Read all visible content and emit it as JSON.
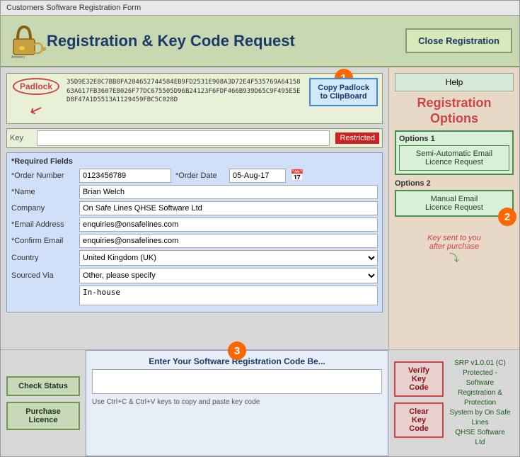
{
  "window": {
    "title": "Customers Software Registration Form"
  },
  "header": {
    "title": "Registration & Key Code Request",
    "close_btn": "Close Registration"
  },
  "padlock": {
    "label": "Padlock",
    "copy_btn_line1": "Copy Padlock",
    "copy_btn_line2": "to ClipBoard",
    "codes": "35D9E32E8C7BB8FA204652744584EB9FD2531E908A3D72E4F535769A6415863A617FB3607E8026F77DC675505D96B24123F6FDF466B939D65C9F495E5ED8F47A1D5513A1129459FBC5C028D",
    "badge_number": "1"
  },
  "key_row": {
    "label": "Key",
    "restricted_label": "Restricted"
  },
  "form": {
    "required_label": "*Required Fields",
    "order_number_label": "*Order Number",
    "order_number_value": "0123456789",
    "order_date_label": "*Order Date",
    "order_date_value": "05-Aug-17",
    "name_label": "*Name",
    "name_value": "Brian Welch",
    "company_label": "Company",
    "company_value": "On Safe Lines QHSE Software Ltd",
    "email_label": "*Email Address",
    "email_value": "enquiries@onsafelines.com",
    "confirm_email_label": "*Confirm Email",
    "confirm_email_value": "enquiries@onsafelines.com",
    "country_label": "Country",
    "country_value": "United Kingdom (UK)",
    "sourced_label": "Sourced Via",
    "sourced_value": "Other, please specify",
    "inhouse_value": "In-house"
  },
  "bottom": {
    "check_btn": "Check Status",
    "purchase_btn": "Purchase\nLicence",
    "reg_code_title": "Enter Your Software Registration Code Be...",
    "reg_hint": "Use Ctrl+C & Ctrl+V keys to copy and paste key code",
    "verify_line1": "Verify",
    "verify_line2": "Key Code",
    "clear_line1": "Clear",
    "clear_line2": "Key Code",
    "badge_number": "3",
    "srp_text": "SRP v1.0.01 (C)\nProtected - Software\nRegistration & Protection\nSystem by On Safe Lines\nQHSE Software Ltd"
  },
  "right_panel": {
    "help_btn": "Help",
    "reg_options_title": "Registration\nOptions",
    "options1_label": "Options 1",
    "options1_btn": "Semi-Automatic Email\nLicence Request",
    "options2_label": "Options 2",
    "options2_btn": "Manual Email\nLicence Request",
    "key_sent_text": "Key sent to you\nafter purchase",
    "badge_number": "2"
  },
  "colors": {
    "orange": "#ff6600",
    "red": "#cc2222",
    "green": "#4a8a4a",
    "blue": "#1a3a6a",
    "light_green_bg": "#c8d8b0"
  }
}
